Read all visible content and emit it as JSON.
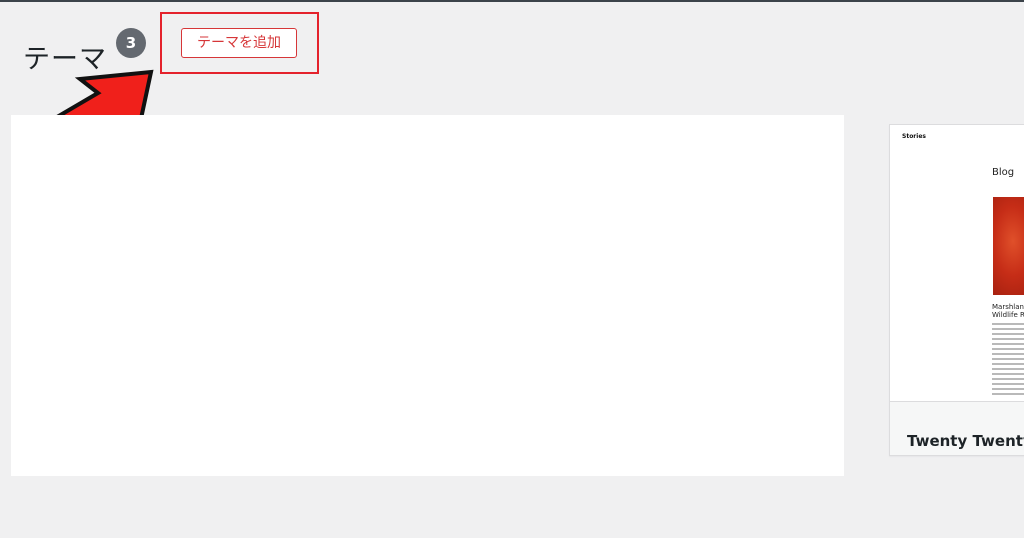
{
  "header": {
    "title": "テーマ",
    "count": "3",
    "add_button_label": "テーマを追加"
  },
  "annotation": {
    "arrow_color": "#f0201b",
    "highlight_color": "#e4222c"
  },
  "theme_card": {
    "name": "Twenty Twenty",
    "screenshot": {
      "site_name": "Stories",
      "heading": "Blog",
      "post_title_line1": "Marshland",
      "post_title_line2": "Wildlife Re",
      "image_color": "#c62d17"
    }
  },
  "colors": {
    "background": "#f0f0f1",
    "badge": "#646970",
    "button_text": "#d63638"
  }
}
